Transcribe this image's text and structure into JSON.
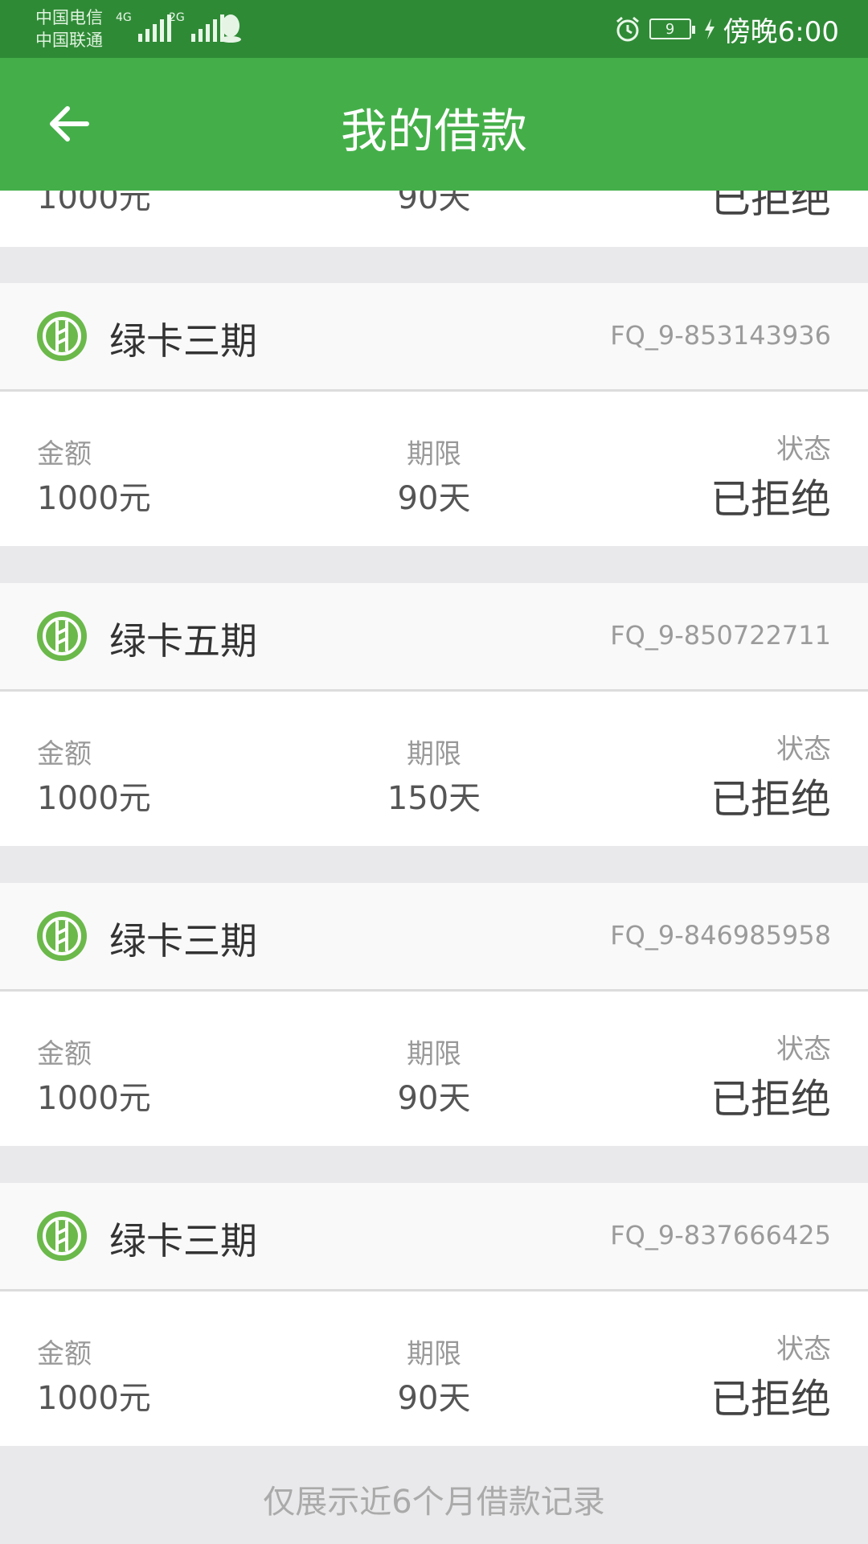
{
  "status_bar": {
    "carrier1": "中国电信",
    "carrier2": "中国联通",
    "net1": "4G",
    "net2": "2G",
    "battery": "9",
    "time": "傍晚6:00"
  },
  "app_bar": {
    "title": "我的借款"
  },
  "partial_record": {
    "amount": "1000元",
    "term": "90天",
    "status": "已拒绝"
  },
  "labels": {
    "amount": "金额",
    "term": "期限",
    "status": "状态"
  },
  "records": [
    {
      "name": "绿卡三期",
      "id": "FQ_9-853143936",
      "amount": "1000元",
      "term": "90天",
      "status": "已拒绝"
    },
    {
      "name": "绿卡五期",
      "id": "FQ_9-850722711",
      "amount": "1000元",
      "term": "150天",
      "status": "已拒绝"
    },
    {
      "name": "绿卡三期",
      "id": "FQ_9-846985958",
      "amount": "1000元",
      "term": "90天",
      "status": "已拒绝"
    },
    {
      "name": "绿卡三期",
      "id": "FQ_9-837666425",
      "amount": "1000元",
      "term": "90天",
      "status": "已拒绝"
    }
  ],
  "footer_note": "仅展示近6个月借款记录",
  "colors": {
    "primary": "#44af49",
    "status_bar": "#2f8a36",
    "background": "#e9e9eb"
  }
}
